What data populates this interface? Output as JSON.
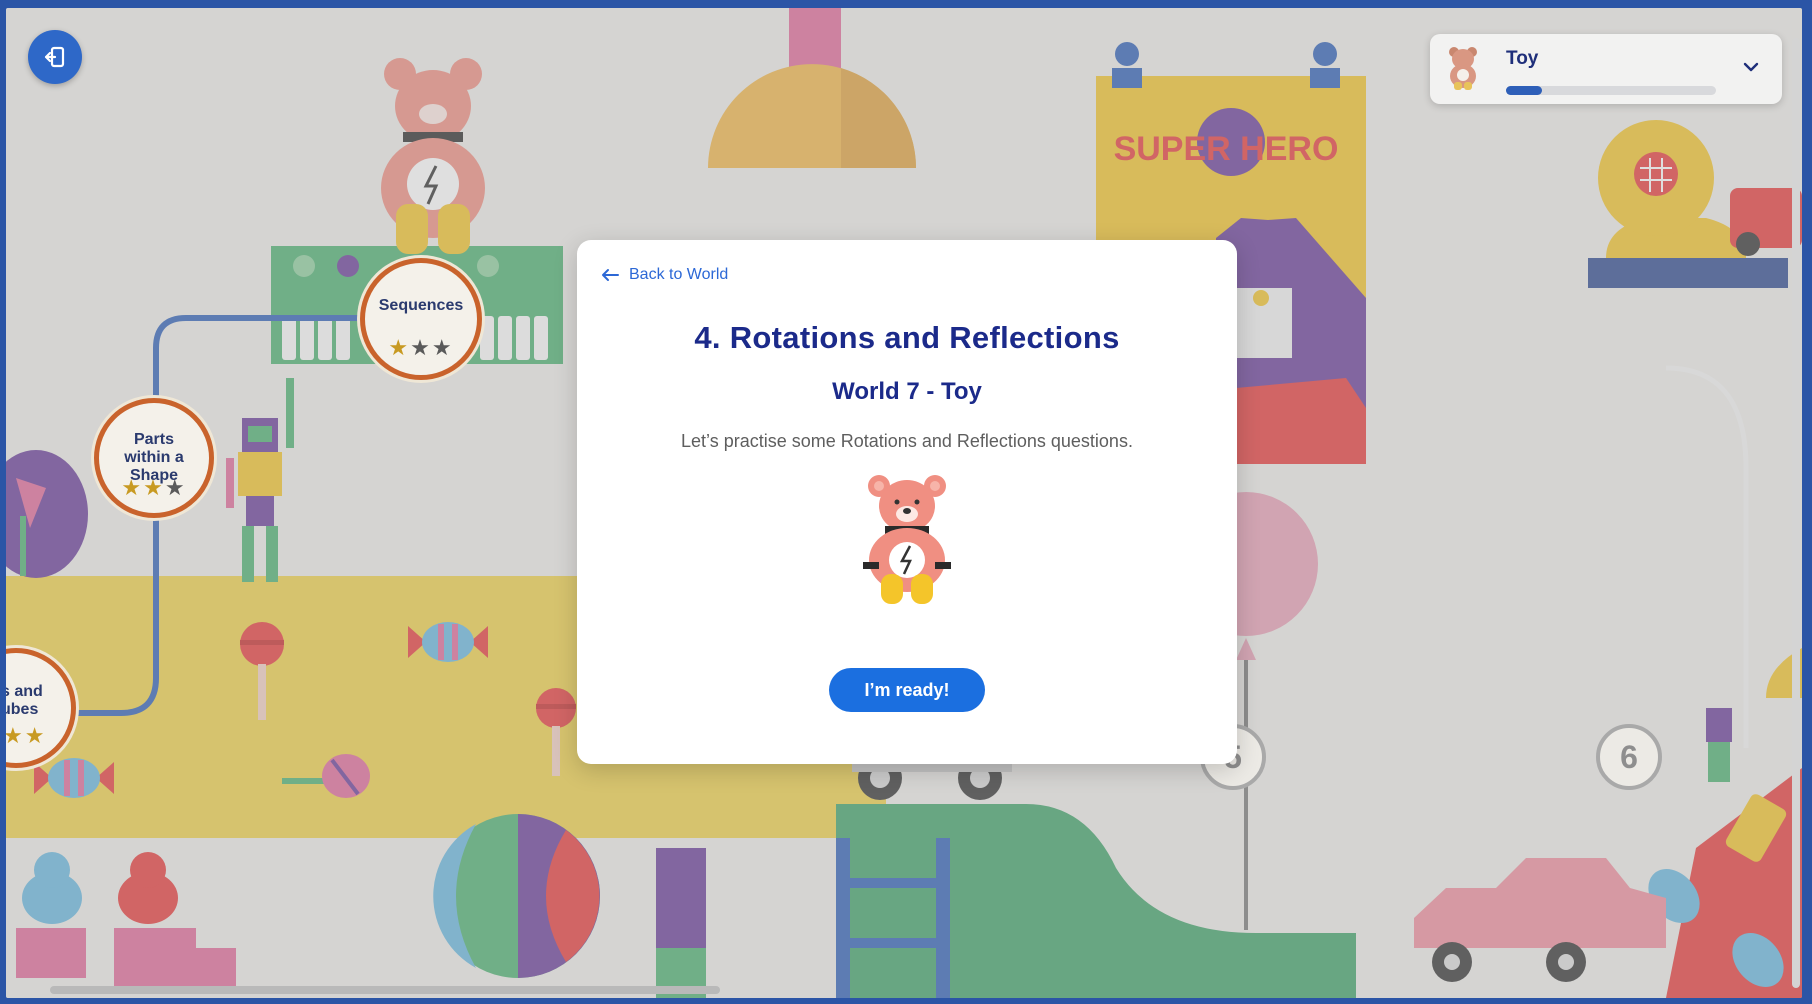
{
  "world_selector": {
    "name": "Toy",
    "progress": 0.17,
    "icon": "teddy-bear-icon",
    "expand_icon": "chevron-down-icon"
  },
  "exit_button": {
    "icon": "exit-icon"
  },
  "map": {
    "nodes": [
      {
        "label": "Sequences",
        "stars_earned": 1,
        "stars_total": 3
      },
      {
        "label": "Parts within a Shape",
        "stars_earned": 2,
        "stars_total": 3
      },
      {
        "label": "s and ubes",
        "stars_earned": 2,
        "stars_total": 2
      }
    ],
    "numbered_nodes": [
      "5",
      "6"
    ],
    "poster_text": "SUPER HERO"
  },
  "modal": {
    "back_label": "Back to World",
    "title": "4. Rotations and Reflections",
    "subtitle": "World 7 - Toy",
    "description": "Let’s practise some Rotations and Reflections questions.",
    "ready_label": "I’m ready!",
    "illustration": "teddy-bear-illustration"
  },
  "colors": {
    "frame": "#2b55a6",
    "title": "#1b2a8a",
    "button": "#1b6fe0",
    "link": "#2c68d6"
  }
}
